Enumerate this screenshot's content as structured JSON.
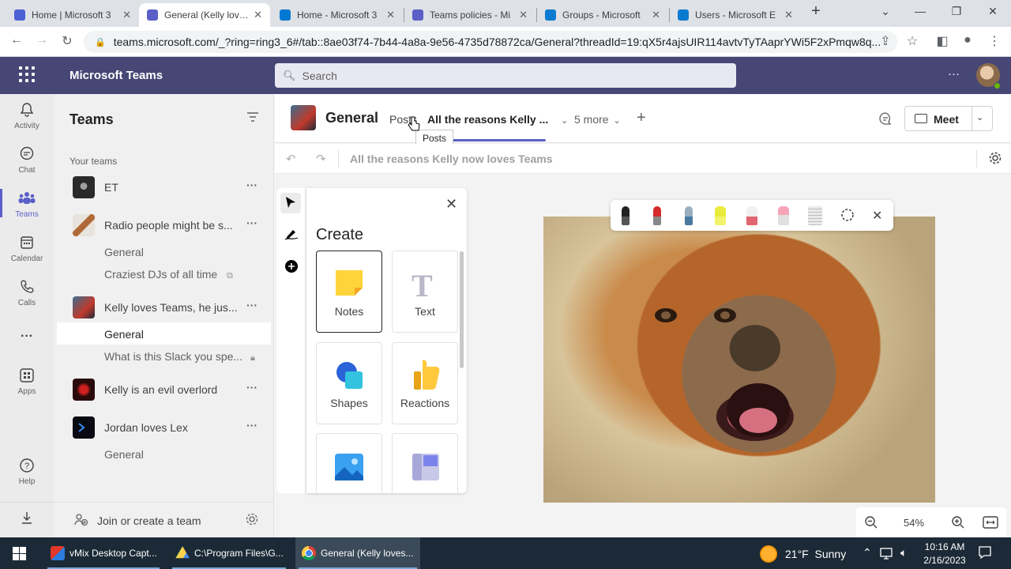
{
  "browser": {
    "tabs": [
      {
        "title": "Home | Microsoft 3",
        "color": "#4c5fd5"
      },
      {
        "title": "General (Kelly loves",
        "color": "#5b5fc7"
      },
      {
        "title": "Home - Microsoft 3",
        "color": "#0078d4"
      },
      {
        "title": "Teams policies - Mi",
        "color": "#5b5fc7"
      },
      {
        "title": "Groups - Microsoft",
        "color": "#0a7bd1"
      },
      {
        "title": "Users - Microsoft E",
        "color": "#0a7bd1"
      }
    ],
    "new_tab": "+",
    "url": "teams.microsoft.com/_?ring=ring3_6#/tab::8ae03f74-7b44-4a8a-9e56-4735d78872ca/General?threadId=19:qX5r4ajsUIR114avtvTyTAaprYWi5F2xPmqw8q..."
  },
  "teams": {
    "app_title": "Microsoft Teams",
    "search_placeholder": "Search",
    "header_more": "···"
  },
  "rail": [
    {
      "label": "Activity",
      "icon": "bell-icon",
      "glyph": "🔔"
    },
    {
      "label": "Chat",
      "icon": "chat-icon",
      "glyph": "💬"
    },
    {
      "label": "Teams",
      "icon": "teams-icon",
      "glyph": "👥"
    },
    {
      "label": "Calendar",
      "icon": "calendar-icon",
      "glyph": "📅"
    },
    {
      "label": "Calls",
      "icon": "phone-icon",
      "glyph": "📞"
    },
    {
      "label": "···",
      "icon": "more-icon",
      "glyph": ""
    },
    {
      "label": "Apps",
      "icon": "apps-icon",
      "glyph": "▦"
    },
    {
      "label": "Help",
      "icon": "help-icon",
      "glyph": "?"
    }
  ],
  "teams_list": {
    "title": "Teams",
    "section": "Your teams",
    "items": [
      {
        "name": "ET"
      },
      {
        "name": "Radio people might be s..."
      },
      {
        "name": "Kelly loves Teams, he jus..."
      },
      {
        "name": "Kelly is an evil overlord"
      },
      {
        "name": "Jordan loves Lex"
      }
    ],
    "channels": {
      "radio_general": "General",
      "craziest": "Craziest DJs of all time",
      "kelly_general": "General",
      "slack": "What is this Slack you spe...",
      "jordan_general": "General"
    },
    "item_more": "···",
    "join": "Join or create a team"
  },
  "channel": {
    "name": "General",
    "tabs": [
      "Posts",
      "All the reasons Kelly ...",
      "5 more"
    ],
    "add_tab": "+",
    "tooltip": "Posts",
    "meet": "Meet"
  },
  "whiteboard": {
    "title": "All the reasons Kelly now loves Teams",
    "create_title": "Create",
    "cards": [
      "Notes",
      "Text",
      "Shapes",
      "Reactions",
      "",
      ""
    ],
    "zoom": "54%"
  },
  "taskbar": {
    "apps": [
      "vMix Desktop Capt...",
      "C:\\Program Files\\G...",
      "General (Kelly loves..."
    ],
    "weather": "21°F  Sunny",
    "time": "10:16 AM",
    "date": "2/16/2023"
  }
}
